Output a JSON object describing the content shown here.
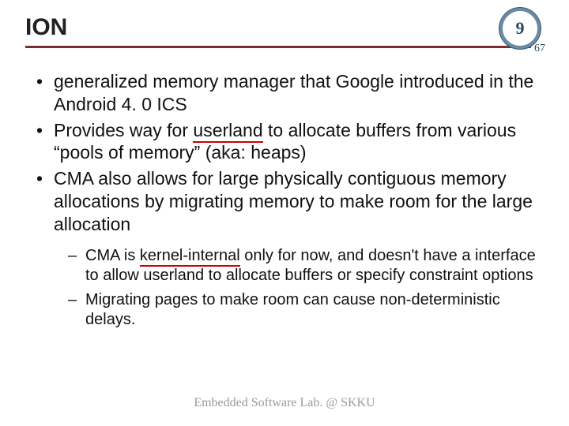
{
  "header": {
    "title": "ION",
    "page_current": "9",
    "page_total": "67"
  },
  "bullets": [
    {
      "pre": "generalized memory manager that Google introduced in the Android 4. 0 ICS"
    },
    {
      "pre": "Provides way for ",
      "underline": "userland",
      "post": " to allocate buffers from various “pools of memory” (aka: heaps)"
    },
    {
      "pre": "CMA also allows for large physically contiguous memory allocations by migrating memory to make room for the large allocation"
    }
  ],
  "subbullets": [
    {
      "pre": "CMA is ",
      "underline": "kernel-internal",
      "post": " only for now, and doesn't have a interface to allow userland to allocate buffers or specify constraint options"
    },
    {
      "pre": "Migrating pages to make room can cause non-deterministic delays."
    }
  ],
  "footer": "Embedded Software Lab. @ SKKU"
}
